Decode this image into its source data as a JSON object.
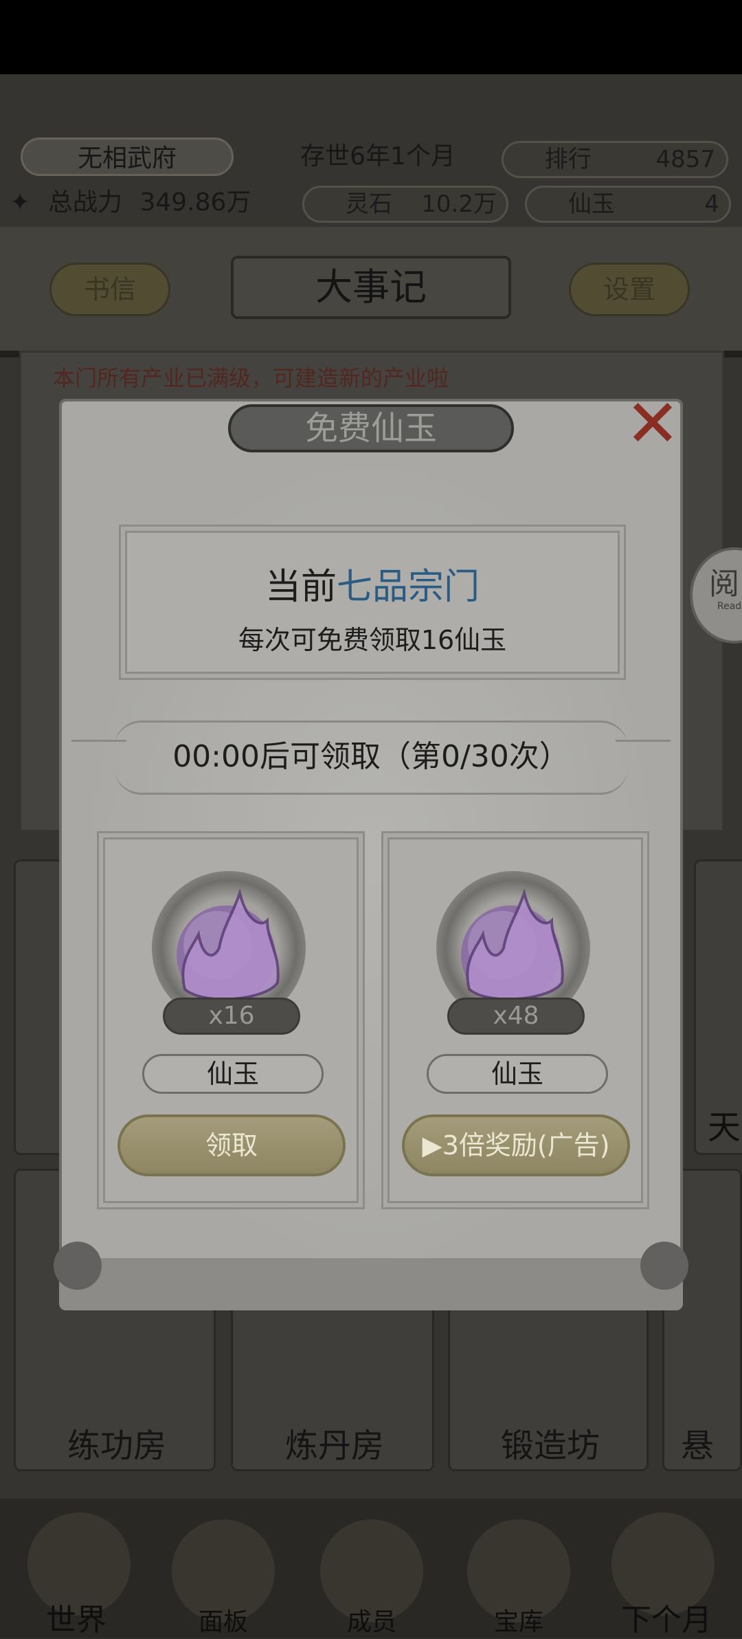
{
  "header": {
    "sect_name": "无相武府",
    "era": "存世6年1个月",
    "rank_label": "排行",
    "rank_value": "4857",
    "power_label": "总战力",
    "power_value": "349.86万",
    "spirit_stone_label": "灵石",
    "spirit_stone_value": "10.2万",
    "jade_label": "仙玉",
    "jade_value": "4"
  },
  "toolbar": {
    "letters_label": "书信",
    "title": "大事记",
    "settings_label": "设置"
  },
  "event_log": {
    "line1": "本门所有产业已满级，可建造新的产业啦"
  },
  "buildings": [
    {
      "label": "练功房"
    },
    {
      "label": "炼丹房"
    },
    {
      "label": "锻造坊"
    },
    {
      "label": "悬"
    }
  ],
  "side_label": "天",
  "bottom_nav": [
    {
      "label": "世界"
    },
    {
      "label": "面板"
    },
    {
      "label": "成员"
    },
    {
      "label": "宝库"
    },
    {
      "label": "下个月"
    }
  ],
  "read_badge": {
    "label": "阅",
    "sub": "Read"
  },
  "modal": {
    "title": "免费仙玉",
    "info_prefix": "当前",
    "info_sect_rank": "七品宗门",
    "info_line2": "每次可免费领取16仙玉",
    "timer_text": "00:00后可领取（第0/30次）",
    "rewards": [
      {
        "count": "x16",
        "name": "仙玉",
        "button": "领取"
      },
      {
        "count": "x48",
        "name": "仙玉",
        "button": "▶3倍奖励(广告)"
      }
    ]
  },
  "colors": {
    "accent_blue": "#2a5b82",
    "close_red": "#8a2d22",
    "gold_button": "#a49c7a",
    "jade_purple": "#8c6fa3"
  }
}
